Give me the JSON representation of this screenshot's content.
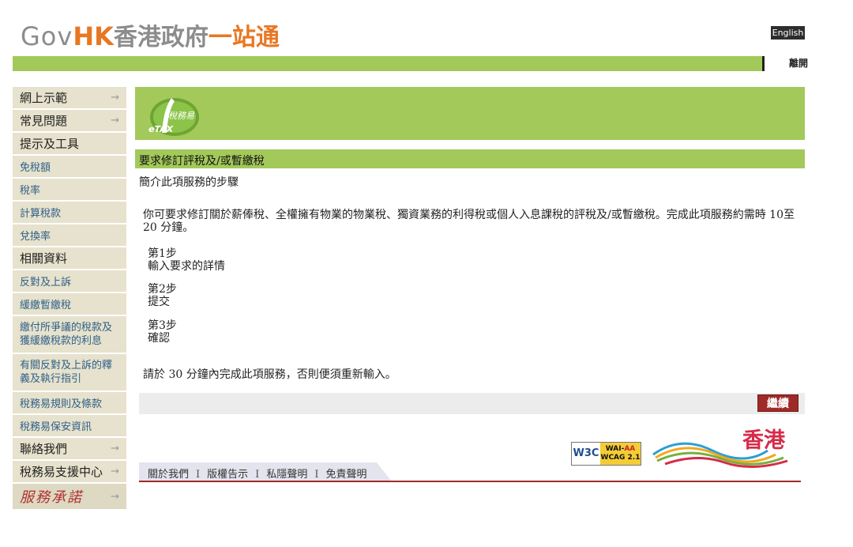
{
  "header": {
    "logo_gov": "Gov",
    "logo_hk": "HK",
    "logo_cn": "香港政府",
    "logo_cn2": "一站通",
    "lang_button": "English",
    "exit_button": "離開"
  },
  "sidebar": {
    "items": [
      {
        "label": "網上示範",
        "arrow": "→"
      },
      {
        "label": "常見問題",
        "arrow": "→"
      },
      {
        "label": "提示及工具"
      },
      {
        "label": "免稅額"
      },
      {
        "label": "稅率"
      },
      {
        "label": "計算稅款"
      },
      {
        "label": "兌換率"
      },
      {
        "label": "相關資料"
      },
      {
        "label": "反對及上訴"
      },
      {
        "label": "緩繳暫繳稅"
      },
      {
        "label": "繳付所爭議的稅款及獲緩繳稅款的利息"
      },
      {
        "label": "有關反對及上訴的釋義及執行指引"
      },
      {
        "label": "稅務易規則及條款"
      },
      {
        "label": "稅務易保安資訊"
      },
      {
        "label": "聯絡我們",
        "arrow": "→"
      },
      {
        "label": "稅務易支援中心",
        "arrow": "→"
      },
      {
        "label": "服務承諾",
        "arrow": "→"
      }
    ]
  },
  "banner": {
    "logo_cn": "稅務易",
    "logo_en": "eTAX"
  },
  "main": {
    "section_title": "要求修訂評稅及/或暫繳稅",
    "intro": "簡介此項服務的步驟",
    "description": "你可要求修訂關於薪俸稅、全權擁有物業的物業稅、獨資業務的利得稅或個人入息課稅的評稅及/或暫繳稅。完成此項服務約需時 10至20 分鐘。",
    "steps": [
      {
        "title": "第1步",
        "text": "輸入要求的詳情"
      },
      {
        "title": "第2步",
        "text": "提交"
      },
      {
        "title": "第3步",
        "text": "確認"
      }
    ],
    "note": "請於 30 分鐘內完成此項服務，否則便須重新輸入。",
    "continue_button": "繼續"
  },
  "footer": {
    "links": [
      "關於我們",
      "版權告示",
      "私隱聲明",
      "免責聲明"
    ],
    "separator": "I",
    "w3c": "W3C",
    "wai_line1": "WAI-",
    "wai_aa": "AA",
    "wai_line2": "WCAG 2.1",
    "brand_text": "香港"
  }
}
